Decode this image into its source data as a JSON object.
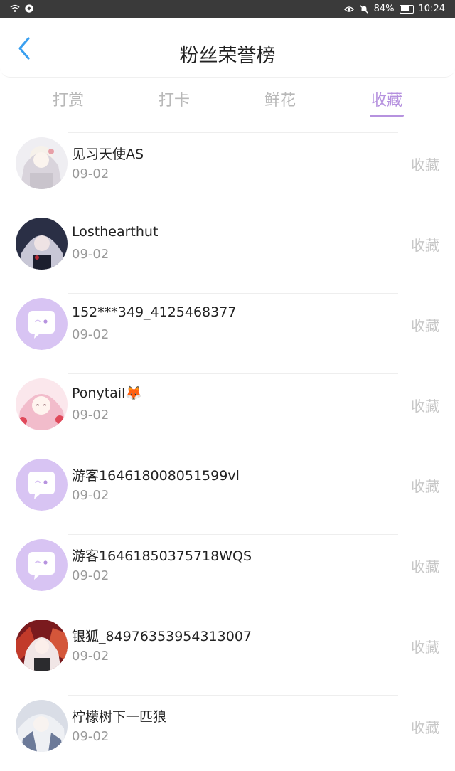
{
  "status_bar": {
    "battery": "84%",
    "time": "10:24"
  },
  "header": {
    "title": "粉丝荣誉榜"
  },
  "tabs": [
    {
      "label": "打赏",
      "active": false
    },
    {
      "label": "打卡",
      "active": false
    },
    {
      "label": "鲜花",
      "active": false
    },
    {
      "label": "收藏",
      "active": true
    }
  ],
  "colors": {
    "accent": "#b692df",
    "default_avatar": "#d8c4f3"
  },
  "rows": [
    {
      "name": "见习天使AS",
      "date": "09-02",
      "action": "收藏",
      "avatar": "photo"
    },
    {
      "name": "Losthearthut",
      "date": "09-02",
      "action": "收藏",
      "avatar": "photo"
    },
    {
      "name": "152***349_4125468377",
      "date": "09-02",
      "action": "收藏",
      "avatar": "default"
    },
    {
      "name": "Ponytail🦊",
      "date": "09-02",
      "action": "收藏",
      "avatar": "photo"
    },
    {
      "name": "游客164618008051599vl",
      "date": "09-02",
      "action": "收藏",
      "avatar": "default"
    },
    {
      "name": "游客16461850375718WQS",
      "date": "09-02",
      "action": "收藏",
      "avatar": "default"
    },
    {
      "name": "银狐_84976353954313007",
      "date": "09-02",
      "action": "收藏",
      "avatar": "photo"
    },
    {
      "name": "柠檬树下一匹狼",
      "date": "09-02",
      "action": "收藏",
      "avatar": "photo"
    }
  ]
}
